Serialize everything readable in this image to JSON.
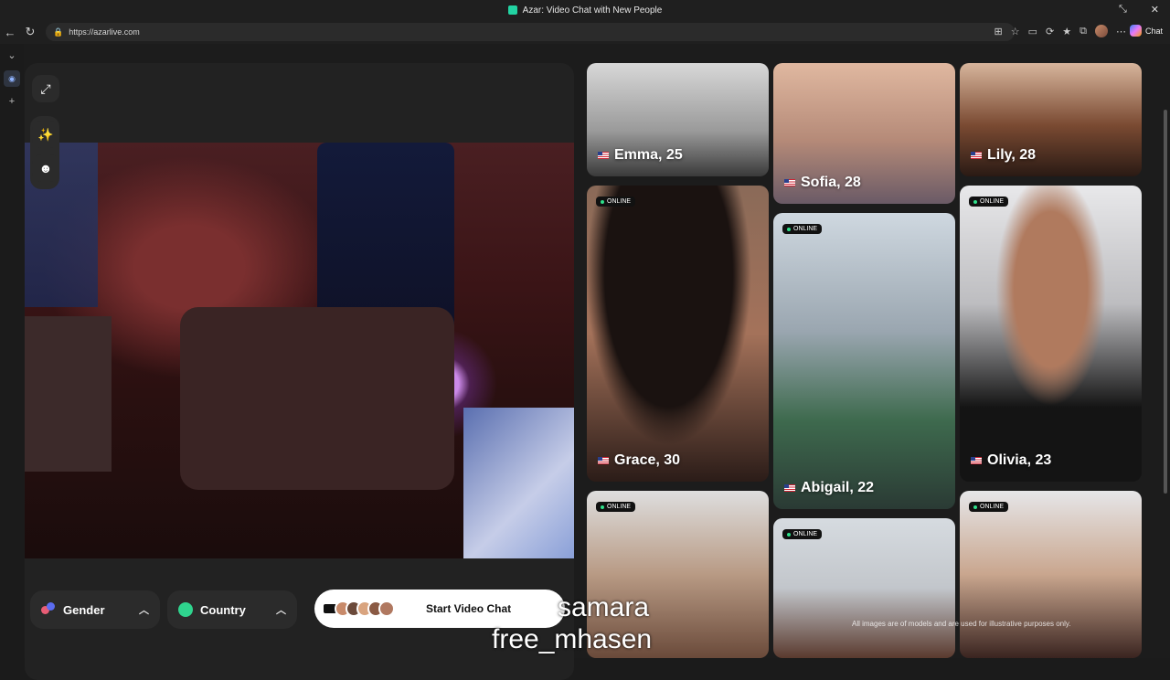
{
  "browser": {
    "window_title": "Azar: Video Chat with New People",
    "url": "https://azarlive.com",
    "chat_label": "Chat"
  },
  "controls": {
    "gender_label": "Gender",
    "country_label": "Country",
    "start_label": "Start Video Chat"
  },
  "profiles": [
    {
      "name": "Emma, 25",
      "online": false
    },
    {
      "name": "Sofia, 28",
      "online": false
    },
    {
      "name": "Lily, 28",
      "online": false
    },
    {
      "name": "Grace, 30",
      "online": true
    },
    {
      "name": "Abigail, 22",
      "online": true
    },
    {
      "name": "Olivia, 23",
      "online": true
    },
    {
      "name": "",
      "online": true
    },
    {
      "name": "",
      "online": true
    },
    {
      "name": "",
      "online": true
    }
  ],
  "online_label": "ONLINE",
  "disclaimer": "All images are of models and are used for illustrative purposes only.",
  "captions": {
    "line1": "samara",
    "line2": "free_mhasen"
  },
  "colors": {
    "online_dot": "#2fe08a",
    "accent": "#22d3a2"
  }
}
